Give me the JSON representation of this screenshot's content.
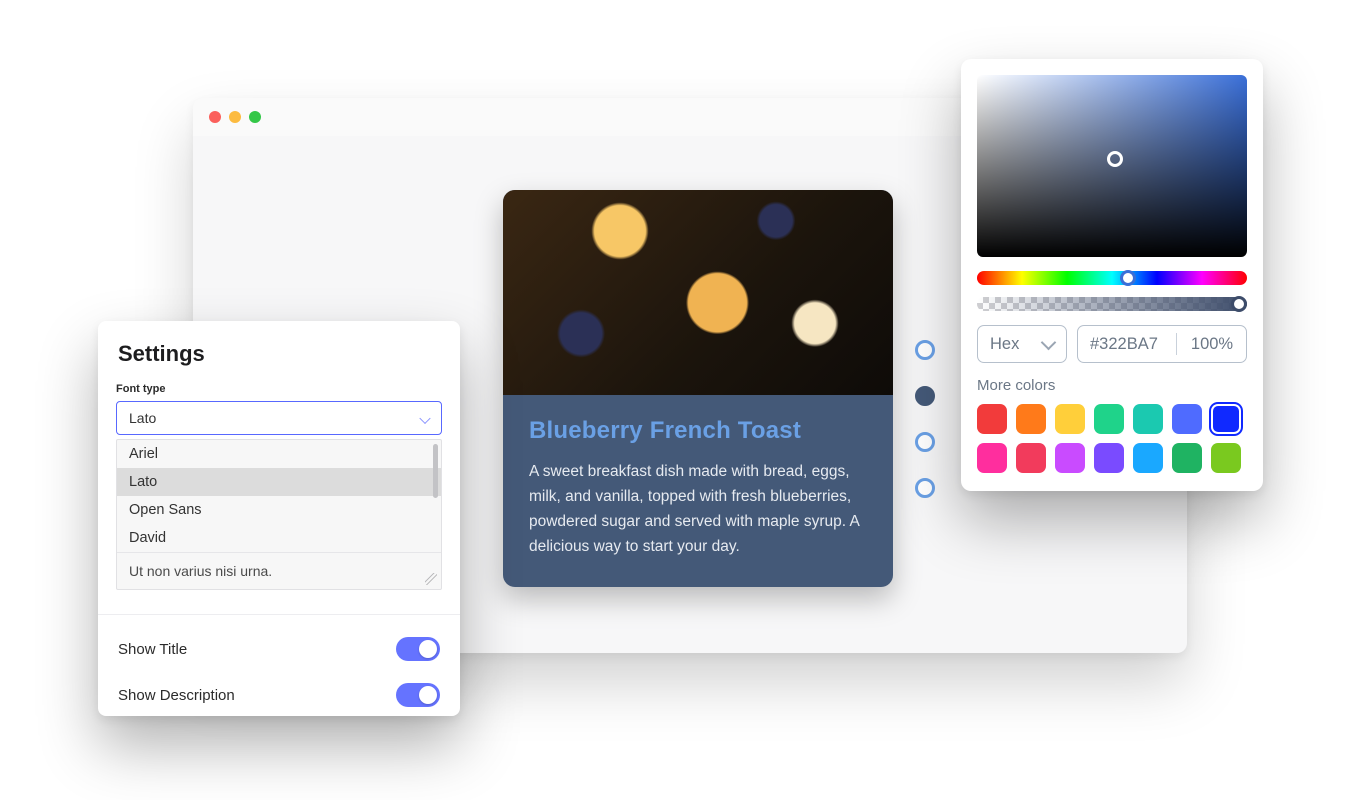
{
  "settings": {
    "title": "Settings",
    "font_type_label": "Font type",
    "selected_font": "Lato",
    "font_options": [
      "Ariel",
      "Lato",
      "Open Sans",
      "David"
    ],
    "textarea_value": "Ut non varius nisi urna.",
    "show_title_label": "Show Title",
    "show_title_on": true,
    "show_description_label": "Show Description",
    "show_description_on": true
  },
  "card": {
    "title": "Blueberry French Toast",
    "description": "A sweet breakfast dish made with bread, eggs, milk, and vanilla, topped with fresh blueberries, powdered sugar and served with maple syrup. A delicious way to start your day."
  },
  "dots": {
    "count": 4,
    "active_index": 1
  },
  "picker": {
    "mode_label": "Hex",
    "hex_value": "#322BA7",
    "opacity_label": "100%",
    "more_colors_label": "More colors",
    "swatches": [
      "#F23B3B",
      "#FF7A1A",
      "#FFCF3A",
      "#1FD38A",
      "#1BC9B0",
      "#4F6BFF",
      "#1029FF",
      "#FF2E9E",
      "#F23B5C",
      "#C94BFF",
      "#7A4BFF",
      "#1AA8FF",
      "#1FB362",
      "#7AC91F"
    ],
    "selected_swatch_index": 6
  }
}
